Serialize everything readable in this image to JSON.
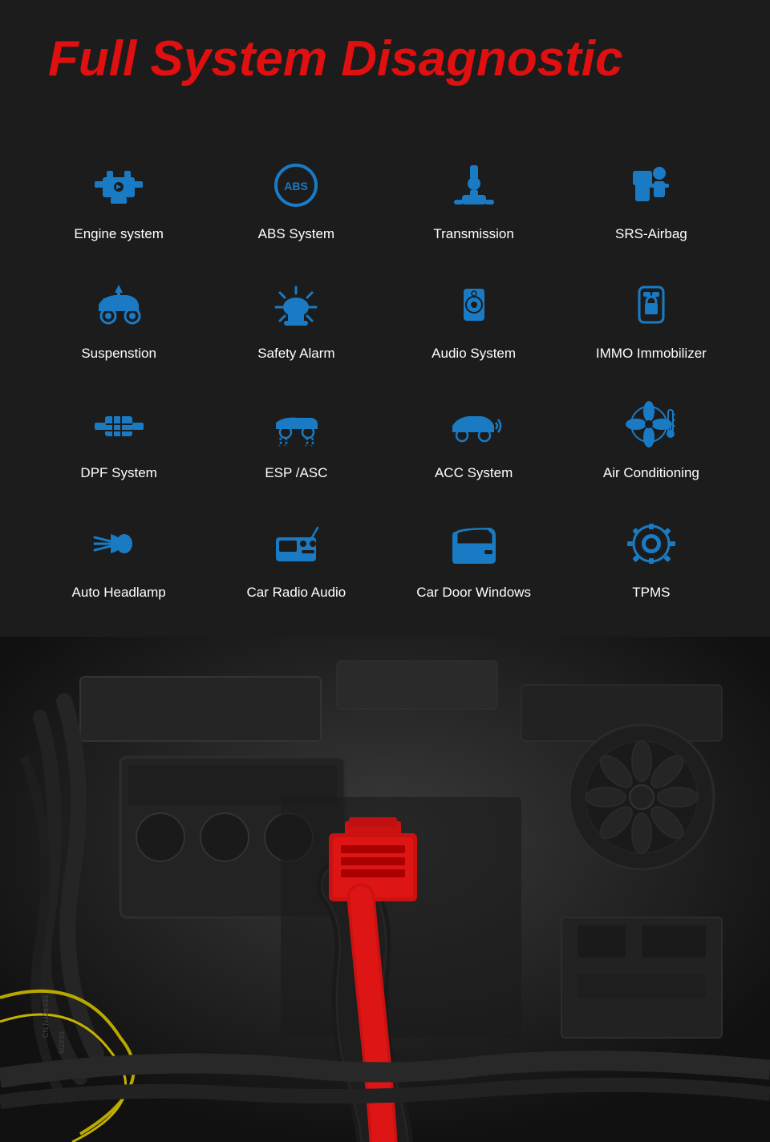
{
  "title": "Full System Disagnostic",
  "accent_color": "#e01010",
  "icon_color": "#1a7bc4",
  "items": [
    {
      "id": "engine-system",
      "label": "Engine system",
      "icon": "engine"
    },
    {
      "id": "abs-system",
      "label": "ABS System",
      "icon": "abs"
    },
    {
      "id": "transmission",
      "label": "Transmission",
      "icon": "transmission"
    },
    {
      "id": "srs-airbag",
      "label": "SRS-Airbag",
      "icon": "airbag"
    },
    {
      "id": "suspension",
      "label": "Suspenstion",
      "icon": "suspension"
    },
    {
      "id": "safety-alarm",
      "label": "Safety Alarm",
      "icon": "alarm"
    },
    {
      "id": "audio-system",
      "label": "Audio System",
      "icon": "audio"
    },
    {
      "id": "immo",
      "label": "IMMO Immobilizer",
      "icon": "immobilizer"
    },
    {
      "id": "dpf-system",
      "label": "DPF System",
      "icon": "dpf"
    },
    {
      "id": "esp-asc",
      "label": "ESP /ASC",
      "icon": "esp"
    },
    {
      "id": "acc-system",
      "label": "ACC System",
      "icon": "acc"
    },
    {
      "id": "air-conditioning",
      "label": "Air Conditioning",
      "icon": "ac"
    },
    {
      "id": "auto-headlamp",
      "label": "Auto Headlamp",
      "icon": "headlamp"
    },
    {
      "id": "car-radio",
      "label": "Car Radio Audio",
      "icon": "radio"
    },
    {
      "id": "car-door",
      "label": "Car Door Windows",
      "icon": "door"
    },
    {
      "id": "tpms",
      "label": "TPMS",
      "icon": "tpms"
    }
  ]
}
